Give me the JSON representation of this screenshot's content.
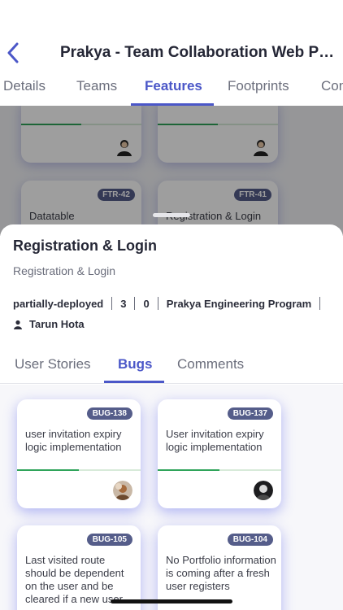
{
  "header": {
    "title": "Prakya - Team Collaboration Web Platf...",
    "tabs": [
      "Details",
      "Teams",
      "Features",
      "Footprints",
      "Con"
    ],
    "active_tab": "Features"
  },
  "background_features": [
    {
      "id": "",
      "name": ""
    },
    {
      "id": "",
      "name": ""
    },
    {
      "id": "FTR-42",
      "name": "Datatable"
    },
    {
      "id": "FTR-41",
      "name": "Registration & Login"
    }
  ],
  "sheet": {
    "title": "Registration & Login",
    "subtitle": "Registration & Login",
    "status": "partially-deployed",
    "count_a": "3",
    "count_b": "0",
    "program": "Prakya Engineering Program",
    "owner": "Tarun Hota",
    "tabs": [
      "User Stories",
      "Bugs",
      "Comments"
    ],
    "active_tab": "Bugs",
    "bugs": [
      {
        "id": "BUG-138",
        "title": "user invitation expiry logic implementation",
        "progress": 0.5
      },
      {
        "id": "BUG-137",
        "title": "User invitation expiry logic implementation",
        "progress": 0.5
      },
      {
        "id": "BUG-105",
        "title": "Last visited route should be dependent on the user and be cleared if a new user",
        "progress": 0
      },
      {
        "id": "BUG-104",
        "title": "No Portfolio information is coming after a fresh user registers",
        "progress": 0
      }
    ]
  },
  "colors": {
    "accent": "#4b57c8",
    "badge": "#555d8a",
    "progress": "#2fa45a"
  }
}
